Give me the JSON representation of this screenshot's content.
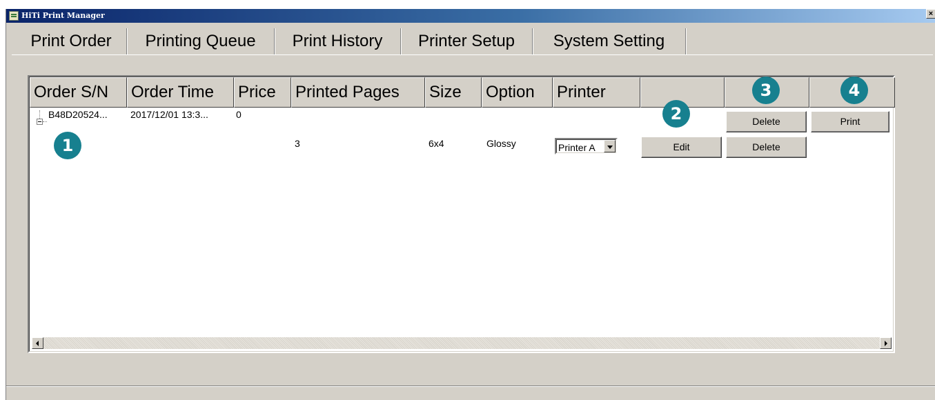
{
  "window": {
    "title": "HiTi Print Manager",
    "close_label": "×"
  },
  "tabs": [
    {
      "label": "Print Order",
      "active": true
    },
    {
      "label": "Printing Queue",
      "active": false
    },
    {
      "label": "Print History",
      "active": false
    },
    {
      "label": "Printer Setup",
      "active": false
    },
    {
      "label": "System Setting",
      "active": false
    }
  ],
  "table": {
    "columns": [
      "Order S/N",
      "Order Time",
      "Price",
      "Printed Pages",
      "Size",
      "Option",
      "Printer",
      "",
      "",
      ""
    ],
    "order_row": {
      "serial": "B48D20524...",
      "time": "2017/12/01 13:3...",
      "price": "0",
      "delete_label": "Delete",
      "print_label": "Print"
    },
    "item_row": {
      "pages": "3",
      "size": "6x4",
      "option": "Glossy",
      "printer": "Printer A",
      "edit_label": "Edit",
      "delete_label": "Delete"
    }
  },
  "badges": [
    "1",
    "2",
    "3",
    "4"
  ],
  "colors": {
    "badge": "#17808f",
    "titlebar_start": "#0a246a",
    "titlebar_end": "#a6caf0",
    "face": "#d4d0c8"
  }
}
